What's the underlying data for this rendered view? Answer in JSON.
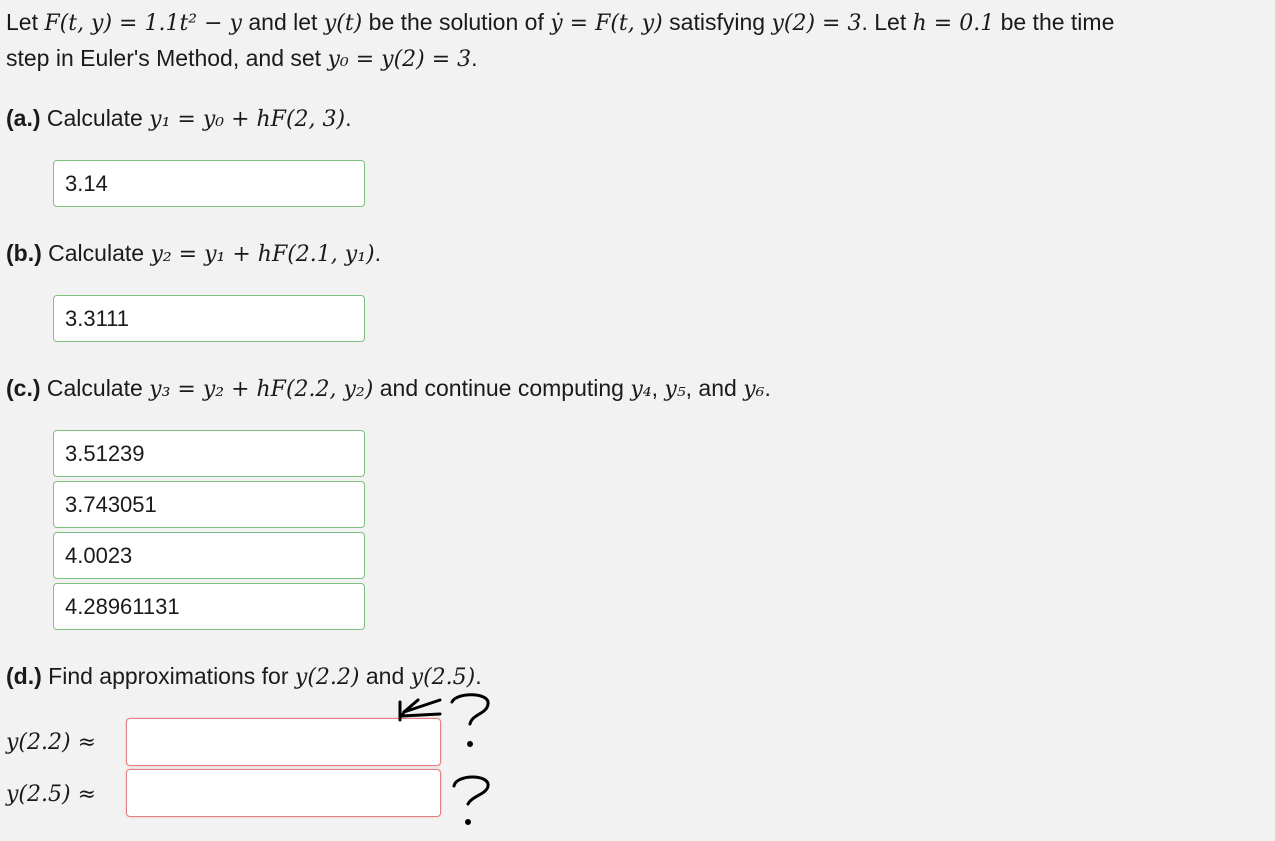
{
  "intro": {
    "let": "Let",
    "F_def": "F(t, y) = 1.1t² − y",
    "and_let": "and let",
    "yt": "y(t)",
    "be_solution": "be the solution of",
    "ode": "ẏ = F(t, y)",
    "satisfying": "satisfying",
    "ic": "y(2) = 3",
    "let_h": ". Let",
    "h_def": "h = 0.1",
    "be_time": "be the time",
    "step_text": "step in Euler's Method, and set",
    "y0_def": "y₀ = y(2) = 3",
    "period": "."
  },
  "part_a": {
    "label": "(a.)",
    "text": "Calculate",
    "formula": "y₁ = y₀ + hF(2, 3)",
    "end": ".",
    "answer": "3.14"
  },
  "part_b": {
    "label": "(b.)",
    "text": "Calculate",
    "formula": "y₂ = y₁ + hF(2.1, y₁)",
    "end": ".",
    "answer": "3.3111"
  },
  "part_c": {
    "label": "(c.)",
    "text": "Calculate",
    "formula": "y₃ = y₂ + hF(2.2, y₂)",
    "continue_text": "and continue computing",
    "y4": "y₄",
    "y5": "y₅",
    "and_text": ", and",
    "y6": "y₆",
    "end": ".",
    "answers": [
      "3.51239",
      "3.743051",
      "4.0023",
      "4.28961131"
    ]
  },
  "part_d": {
    "label": "(d.)",
    "text": "Find approximations for",
    "a": "y(2.2)",
    "and_text": "and",
    "b": "y(2.5)",
    "end": ".",
    "row1_label": "y(2.2) ≈",
    "row2_label": "y(2.5) ≈",
    "row1_value": "",
    "row2_value": ""
  }
}
